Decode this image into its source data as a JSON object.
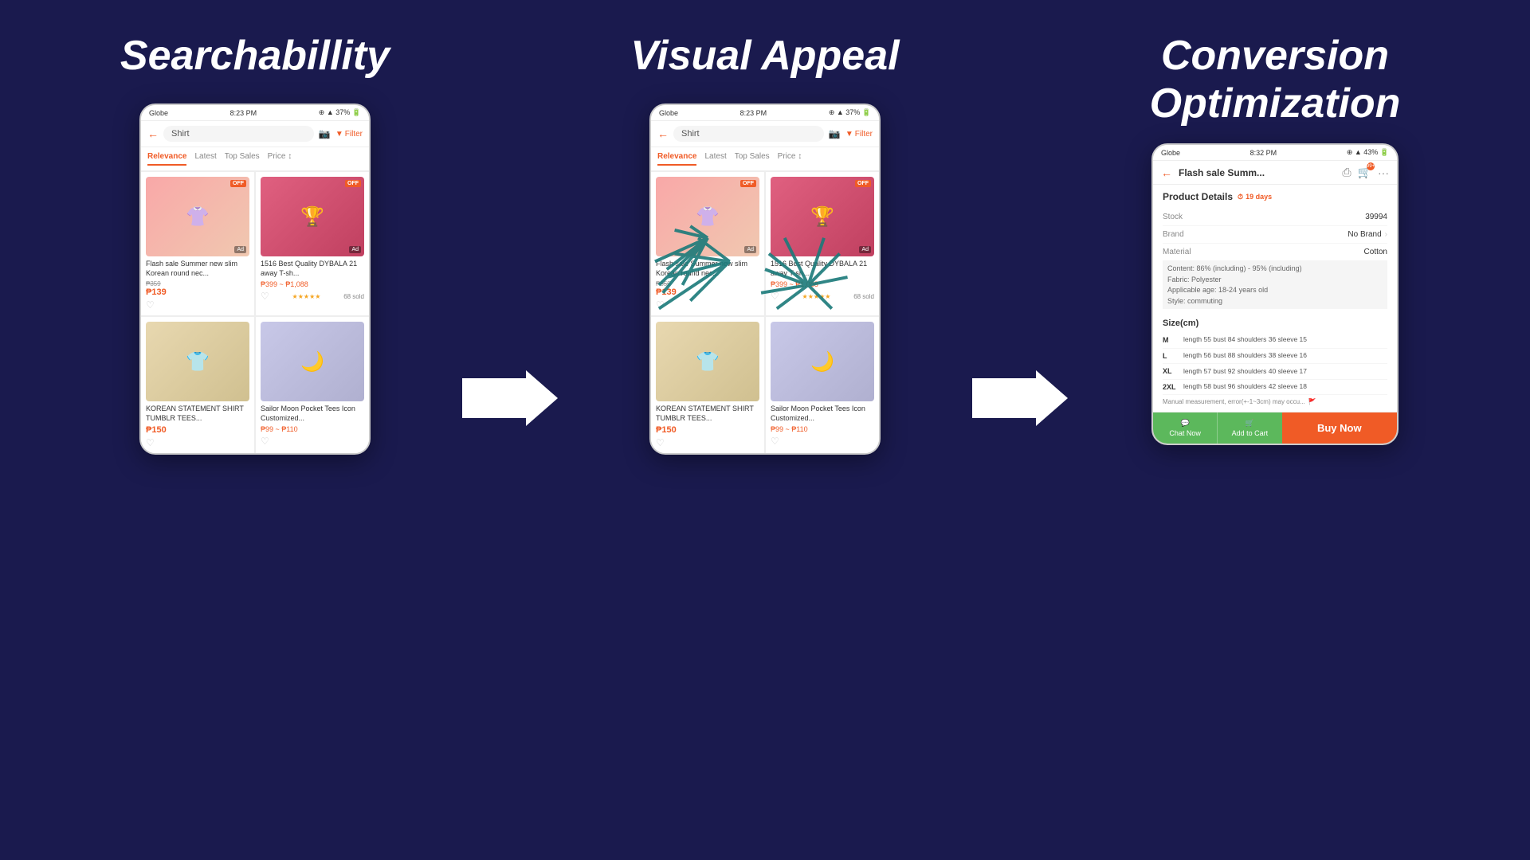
{
  "sections": [
    {
      "id": "searchability",
      "title": "Searchabillity",
      "arrow_after": true
    },
    {
      "id": "visual_appeal",
      "title": "Visual Appeal",
      "arrow_after": true
    },
    {
      "id": "conversion",
      "title": "Conversion Optimization",
      "arrow_after": false
    }
  ],
  "phone1": {
    "status_bar": {
      "carrier": "Globe",
      "time": "8:23 PM",
      "battery": "37%"
    },
    "search_term": "Shirt",
    "tabs": [
      "Relevance",
      "Latest",
      "Top Sales",
      "Price"
    ],
    "active_tab": "Relevance",
    "products": [
      {
        "title": "Flash sale Summer new slim Korean round nec...",
        "price_old": "₱359",
        "price_new": "₱139",
        "has_off": true,
        "is_ad": true,
        "bg": "pink-shirt"
      },
      {
        "title": "1516 Best Quality DYBALA 21 away T-sh...",
        "price_range": "₱399 ~ ₱1,088",
        "has_off": true,
        "is_ad": true,
        "bg": "jeep-shirt",
        "stars": true,
        "sold": "68 sold"
      },
      {
        "title": "KOREAN STATEMENT SHIRT TUMBLR TEES...",
        "price_new": "₱150",
        "bg": "normal-day"
      },
      {
        "title": "Sailor Moon Pocket Tees Icon Customized...",
        "price_range": "₱99 ~ ₱110",
        "bg": "sailor-moon"
      }
    ]
  },
  "phone3": {
    "status_bar": {
      "carrier": "Globe",
      "time": "8:32 PM",
      "battery": "43%"
    },
    "title": "Flash sale Summ...",
    "cart_count": "99+",
    "section_title": "Product Details",
    "days": "19 days",
    "details": [
      {
        "label": "Stock",
        "value": "39994"
      },
      {
        "label": "Brand",
        "value": "No Brand",
        "is_link": true
      },
      {
        "label": "Material",
        "value": "Cotton"
      }
    ],
    "extra_details": {
      "content": "Content: 86% (including) - 95% (including)",
      "fabric": "Fabric: Polyester",
      "age": "Applicable age: 18-24 years old",
      "style": "Style: commuting"
    },
    "size_title": "Size(cm)",
    "sizes": [
      {
        "size": "M",
        "length": "55",
        "bust": "84",
        "shoulders": "36",
        "sleeve": "15"
      },
      {
        "size": "L",
        "length": "56",
        "bust": "88",
        "shoulders": "38",
        "sleeve": "16"
      },
      {
        "size": "XL",
        "length": "57",
        "bust": "92",
        "shoulders": "40",
        "sleeve": "17"
      },
      {
        "size": "2XL",
        "length": "58",
        "bust": "96",
        "shoulders": "42",
        "sleeve": "18"
      }
    ],
    "note": "Manual measurement, error(+-1~3cm) may occu...",
    "actions": {
      "chat": "Chat Now",
      "cart": "Add to Cart",
      "buy": "Buy Now"
    }
  },
  "arrows": {
    "unicode": "➜"
  }
}
